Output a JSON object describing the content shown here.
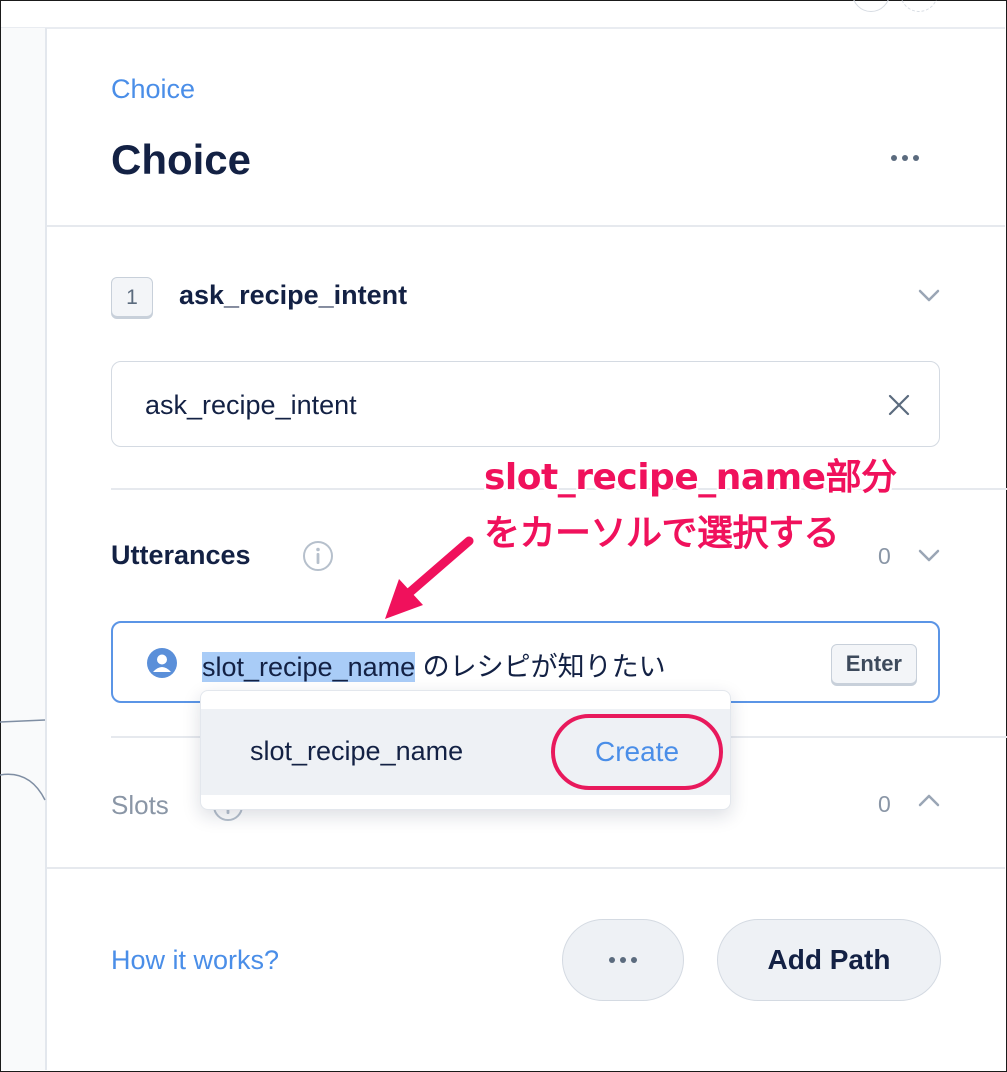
{
  "header": {
    "breadcrumb": "Choice",
    "title": "Choice"
  },
  "intent": {
    "number": "1",
    "name": "ask_recipe_intent",
    "input_value": "ask_recipe_intent"
  },
  "utterances": {
    "label": "Utterances",
    "count": "0",
    "input": {
      "selected_text": "slot_recipe_name",
      "rest_text": " のレシピが知りたい",
      "enter_label": "Enter"
    }
  },
  "dropdown": {
    "option": "slot_recipe_name",
    "create_label": "Create"
  },
  "slots": {
    "label": "Slots",
    "count": "0"
  },
  "footer": {
    "how_link": "How it works?",
    "add_path_label": "Add Path"
  },
  "annotation": {
    "line1": "slot_recipe_name部分",
    "line2": "をカーソルで選択する",
    "color": "#f0115c"
  },
  "colors": {
    "accent": "#4a8ee8",
    "text": "#132144",
    "highlight": "#e8195c"
  }
}
